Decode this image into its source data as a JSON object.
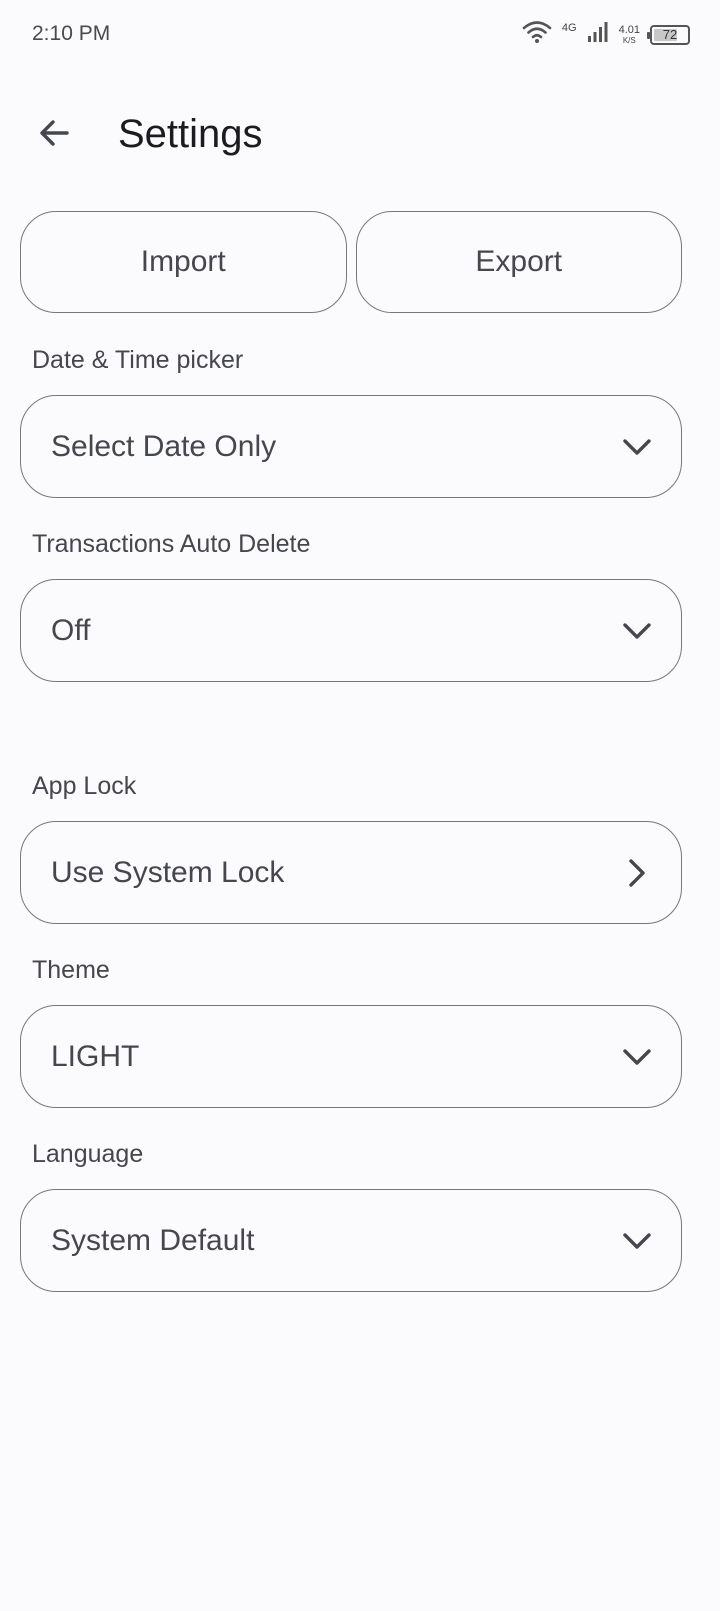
{
  "status_bar": {
    "time": "2:10 PM",
    "network": "4G",
    "speed_value": "4.01",
    "speed_unit": "K/S",
    "battery": "72",
    "battery_level_percent": 72
  },
  "header": {
    "title": "Settings"
  },
  "actions": {
    "import_label": "Import",
    "export_label": "Export"
  },
  "settings": {
    "date_time_picker": {
      "label": "Date & Time picker",
      "value": "Select Date Only"
    },
    "auto_delete": {
      "label": "Transactions Auto Delete",
      "value": "Off"
    },
    "app_lock": {
      "label": "App Lock",
      "value": "Use System Lock"
    },
    "theme": {
      "label": "Theme",
      "value": "LIGHT"
    },
    "language": {
      "label": "Language",
      "value": "System Default"
    }
  },
  "icons": {
    "back": "arrow-left-icon",
    "dropdown": "chevron-down-icon",
    "navigate": "chevron-right-icon",
    "wifi": "wifi-icon",
    "signal": "signal-icon",
    "battery": "battery-icon"
  },
  "colors": {
    "background": "#fbfbfd",
    "outline": "#78767d",
    "text_primary": "#1c1b1f",
    "text_secondary": "#46464f"
  }
}
